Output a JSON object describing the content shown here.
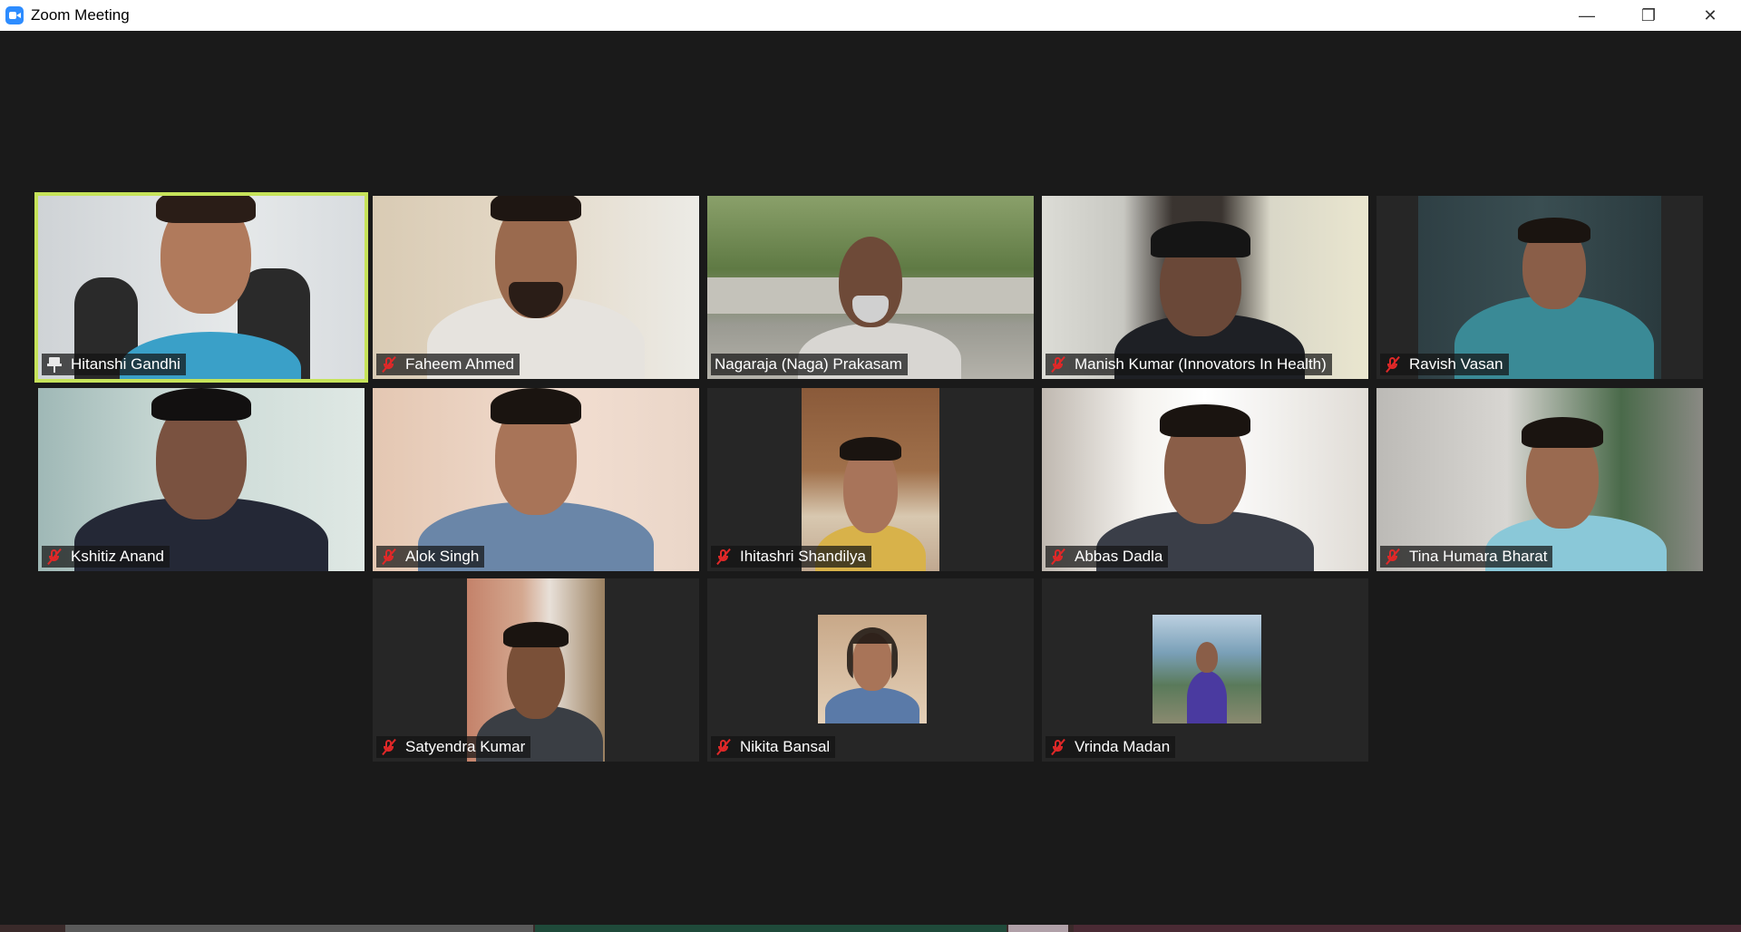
{
  "window": {
    "title": "Zoom Meeting",
    "minimize_glyph": "—",
    "restore_glyph": "❐",
    "close_glyph": "✕"
  },
  "participants": [
    {
      "name": "Hitanshi Gandhi",
      "status_icon": "pin-icon",
      "active_speaker": true
    },
    {
      "name": "Faheem Ahmed",
      "status_icon": "mic-muted-icon"
    },
    {
      "name": "Nagaraja (Naga) Prakasam",
      "status_icon": "none"
    },
    {
      "name": "Manish Kumar (Innovators In Health)",
      "status_icon": "mic-muted-icon"
    },
    {
      "name": "Ravish Vasan",
      "status_icon": "mic-muted-icon"
    },
    {
      "name": "Kshitiz Anand",
      "status_icon": "mic-muted-icon"
    },
    {
      "name": "Alok Singh",
      "status_icon": "mic-muted-icon"
    },
    {
      "name": "Ihitashri Shandilya",
      "status_icon": "mic-muted-icon"
    },
    {
      "name": "Abbas Dadla",
      "status_icon": "mic-muted-icon"
    },
    {
      "name": "Tina Humara Bharat",
      "status_icon": "mic-muted-icon"
    },
    {
      "name": "Satyendra Kumar",
      "status_icon": "mic-muted-icon"
    },
    {
      "name": "Nikita Bansal",
      "status_icon": "mic-muted-icon"
    },
    {
      "name": "Vrinda Madan",
      "status_icon": "mic-muted-icon"
    }
  ],
  "colors": {
    "background": "#1a1a1a",
    "tile": "#262626",
    "active_border": "#c6e35a",
    "muted_icon": "#e02828"
  }
}
